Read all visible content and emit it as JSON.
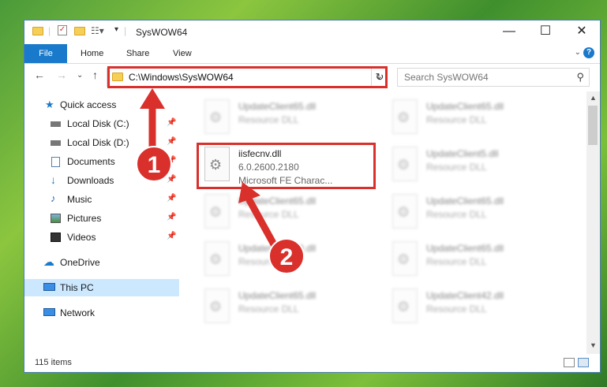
{
  "window": {
    "title": "SysWOW64",
    "minimize_label": "—",
    "maximize_label": "☐",
    "close_label": "✕"
  },
  "ribbon": {
    "tabs": [
      "File",
      "Home",
      "Share",
      "View"
    ],
    "help_label": "?"
  },
  "address": {
    "path": "C:\\Windows\\SysWOW64"
  },
  "search": {
    "placeholder": "Search SysWOW64"
  },
  "navpane": {
    "quick_access": "Quick access",
    "items": [
      {
        "label": "Local Disk (C:)",
        "pinned": true
      },
      {
        "label": "Local Disk (D:)",
        "pinned": true
      },
      {
        "label": "Documents",
        "pinned": true
      },
      {
        "label": "Downloads",
        "pinned": true
      },
      {
        "label": "Music",
        "pinned": true
      },
      {
        "label": "Pictures",
        "pinned": true
      },
      {
        "label": "Videos",
        "pinned": true
      }
    ],
    "onedrive": "OneDrive",
    "this_pc": "This PC",
    "network": "Network"
  },
  "files": {
    "highlighted": {
      "name": "iisfecnv.dll",
      "version": "6.0.2600.2180",
      "description": "Microsoft FE Charac..."
    },
    "background": [
      {
        "name": "UpdateClient65.dll",
        "desc": "Resource DLL"
      },
      {
        "name": "UpdateClient65.dll",
        "desc": "Resource DLL"
      },
      {
        "name": "UpdateClient5.dll",
        "desc": "Resource DLL"
      },
      {
        "name": "UpdateClient65.dll",
        "desc": "Resource DLL"
      },
      {
        "name": "UpdateClient65.dll",
        "desc": "Resource DLL"
      },
      {
        "name": "UpdateClient19.dll",
        "desc": "Resource DLL"
      },
      {
        "name": "UpdateClient65.dll",
        "desc": "Resource DLL"
      },
      {
        "name": "UpdateClient65.dll",
        "desc": "Resource DLL"
      },
      {
        "name": "UpdateClient42.dll",
        "desc": "Resource DLL"
      }
    ]
  },
  "status": {
    "item_count": "115 items"
  },
  "annotations": {
    "step1": "1",
    "step2": "2",
    "color": "#d9302c"
  }
}
